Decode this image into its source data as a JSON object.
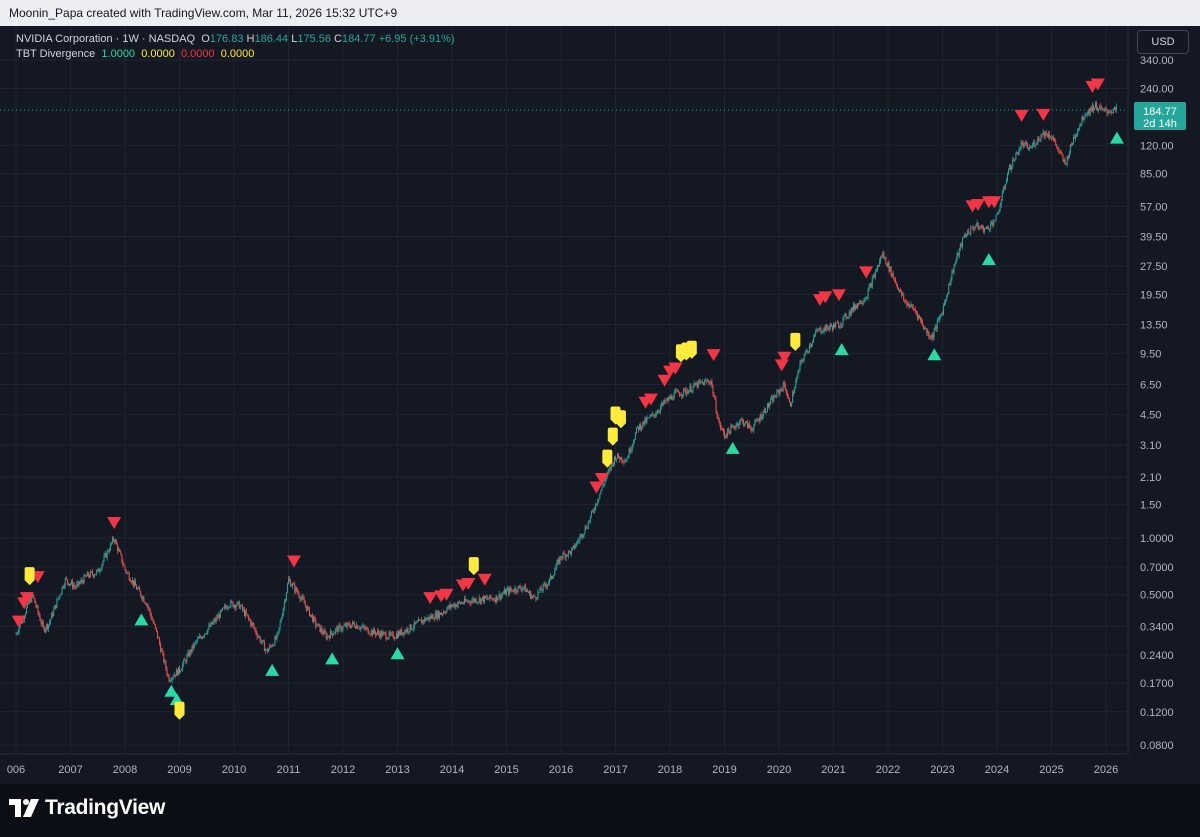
{
  "attribution": "Moonin_Papa created with TradingView.com, Mar 11, 2026 15:32 UTC+9",
  "legend": {
    "symbol": "NVIDIA Corporation · 1W · NASDAQ",
    "o_label": "O",
    "o_value": "176.83",
    "h_label": "H",
    "h_value": "186.44",
    "l_label": "L",
    "l_value": "175.56",
    "c_value": "184.77",
    "change": "+6.95 (+3.91%)",
    "indicator_name": "TBT Divergence",
    "indicator_values": [
      "1.0000",
      "0.0000",
      "0.0000",
      "0.0000"
    ]
  },
  "currency_button": "USD",
  "price_tag": {
    "value": "184.77",
    "countdown": "2d 14h"
  },
  "footer_logo": "TradingView",
  "colors": {
    "bull": "#26a69a",
    "bear": "#ef5350",
    "sell_signal": "#f23645",
    "buy_signal": "#2bd9a5",
    "hidden_signal": "#ffeb3b",
    "tag": "#26a69a"
  },
  "chart_data": {
    "type": "candlestick",
    "y_scale": "log",
    "x_range": [
      2006.0,
      2026.4
    ],
    "y_ticks": [
      "340.00",
      "240.00",
      "120.00",
      "85.00",
      "57.00",
      "39.50",
      "27.50",
      "19.50",
      "13.50",
      "9.50",
      "6.50",
      "4.50",
      "3.10",
      "2.10",
      "1.50",
      "1.0000",
      "0.7000",
      "0.5000",
      "0.3400",
      "0.2400",
      "0.1700",
      "0.1200",
      "0.0800"
    ],
    "x_ticks": [
      "006",
      "2007",
      "2008",
      "2009",
      "2010",
      "2011",
      "2012",
      "2013",
      "2014",
      "2015",
      "2016",
      "2017",
      "2018",
      "2019",
      "2020",
      "2021",
      "2022",
      "2023",
      "2024",
      "2025",
      "2026"
    ],
    "price_path": [
      [
        2006.0,
        0.31
      ],
      [
        2006.3,
        0.5
      ],
      [
        2006.5,
        0.33
      ],
      [
        2006.6,
        0.35
      ],
      [
        2006.9,
        0.6
      ],
      [
        2007.1,
        0.55
      ],
      [
        2007.3,
        0.63
      ],
      [
        2007.5,
        0.66
      ],
      [
        2007.8,
        1.0
      ],
      [
        2008.0,
        0.68
      ],
      [
        2008.2,
        0.55
      ],
      [
        2008.4,
        0.45
      ],
      [
        2008.6,
        0.3
      ],
      [
        2008.8,
        0.18
      ],
      [
        2009.0,
        0.2
      ],
      [
        2009.3,
        0.28
      ],
      [
        2009.6,
        0.35
      ],
      [
        2009.9,
        0.45
      ],
      [
        2010.1,
        0.44
      ],
      [
        2010.3,
        0.36
      ],
      [
        2010.6,
        0.25
      ],
      [
        2010.8,
        0.3
      ],
      [
        2011.0,
        0.6
      ],
      [
        2011.2,
        0.5
      ],
      [
        2011.5,
        0.35
      ],
      [
        2011.7,
        0.3
      ],
      [
        2011.9,
        0.33
      ],
      [
        2012.2,
        0.35
      ],
      [
        2012.5,
        0.32
      ],
      [
        2012.9,
        0.3
      ],
      [
        2013.2,
        0.33
      ],
      [
        2013.5,
        0.37
      ],
      [
        2013.8,
        0.4
      ],
      [
        2014.0,
        0.44
      ],
      [
        2014.4,
        0.47
      ],
      [
        2014.8,
        0.48
      ],
      [
        2015.0,
        0.52
      ],
      [
        2015.3,
        0.55
      ],
      [
        2015.5,
        0.48
      ],
      [
        2015.8,
        0.6
      ],
      [
        2016.0,
        0.8
      ],
      [
        2016.2,
        0.85
      ],
      [
        2016.5,
        1.2
      ],
      [
        2016.8,
        2.0
      ],
      [
        2017.0,
        2.7
      ],
      [
        2017.2,
        2.6
      ],
      [
        2017.4,
        3.8
      ],
      [
        2017.7,
        4.5
      ],
      [
        2017.9,
        5.2
      ],
      [
        2018.1,
        5.8
      ],
      [
        2018.3,
        6.0
      ],
      [
        2018.5,
        6.5
      ],
      [
        2018.75,
        6.8
      ],
      [
        2018.9,
        4.0
      ],
      [
        2019.0,
        3.5
      ],
      [
        2019.3,
        4.2
      ],
      [
        2019.5,
        3.8
      ],
      [
        2019.9,
        5.5
      ],
      [
        2020.1,
        6.5
      ],
      [
        2020.2,
        5.0
      ],
      [
        2020.4,
        8.5
      ],
      [
        2020.7,
        12.5
      ],
      [
        2020.9,
        13.0
      ],
      [
        2021.1,
        13.5
      ],
      [
        2021.4,
        17.0
      ],
      [
        2021.6,
        19.0
      ],
      [
        2021.9,
        32.0
      ],
      [
        2022.1,
        24.0
      ],
      [
        2022.3,
        18.0
      ],
      [
        2022.5,
        16.0
      ],
      [
        2022.7,
        12.5
      ],
      [
        2022.8,
        11.5
      ],
      [
        2023.0,
        16.0
      ],
      [
        2023.2,
        27.0
      ],
      [
        2023.4,
        40.0
      ],
      [
        2023.6,
        45.0
      ],
      [
        2023.8,
        43.0
      ],
      [
        2024.0,
        50.0
      ],
      [
        2024.2,
        87.0
      ],
      [
        2024.45,
        122.0
      ],
      [
        2024.6,
        115.0
      ],
      [
        2024.85,
        140.0
      ],
      [
        2025.0,
        135.0
      ],
      [
        2025.25,
        95.0
      ],
      [
        2025.4,
        130.0
      ],
      [
        2025.6,
        175.0
      ],
      [
        2025.8,
        195.0
      ],
      [
        2025.95,
        182.0
      ],
      [
        2026.2,
        184.77
      ]
    ],
    "sell_signals": [
      [
        2006.05,
        0.36
      ],
      [
        2006.15,
        0.45
      ],
      [
        2006.2,
        0.48
      ],
      [
        2006.4,
        0.62
      ],
      [
        2007.8,
        1.2
      ],
      [
        2011.1,
        0.75
      ],
      [
        2013.6,
        0.48
      ],
      [
        2013.8,
        0.49
      ],
      [
        2013.9,
        0.5
      ],
      [
        2014.2,
        0.56
      ],
      [
        2014.3,
        0.57
      ],
      [
        2014.6,
        0.6
      ],
      [
        2016.65,
        1.85
      ],
      [
        2016.75,
        2.05
      ],
      [
        2017.55,
        5.2
      ],
      [
        2017.65,
        5.4
      ],
      [
        2017.9,
        6.8
      ],
      [
        2018.0,
        7.6
      ],
      [
        2018.1,
        7.9
      ],
      [
        2018.8,
        9.3
      ],
      [
        2020.05,
        8.2
      ],
      [
        2020.1,
        9.0
      ],
      [
        2020.75,
        18.2
      ],
      [
        2020.85,
        18.8
      ],
      [
        2021.1,
        19.3
      ],
      [
        2021.6,
        25.5
      ],
      [
        2023.55,
        57.0
      ],
      [
        2023.65,
        58.0
      ],
      [
        2023.85,
        60.0
      ],
      [
        2023.95,
        60.0
      ],
      [
        2024.45,
        172.0
      ],
      [
        2024.85,
        174.0
      ],
      [
        2025.75,
        245.0
      ],
      [
        2025.85,
        252.0
      ]
    ],
    "buy_signals": [
      [
        2008.3,
        0.37
      ],
      [
        2008.85,
        0.155
      ],
      [
        2008.95,
        0.14
      ],
      [
        2010.7,
        0.2
      ],
      [
        2011.8,
        0.23
      ],
      [
        2013.0,
        0.245
      ],
      [
        2019.15,
        3.0
      ],
      [
        2021.15,
        10.0
      ],
      [
        2022.85,
        9.4
      ],
      [
        2023.85,
        30.0
      ],
      [
        2026.2,
        132.0
      ]
    ],
    "hidden_signals": [
      [
        2006.25,
        0.62
      ],
      [
        2009.0,
        0.12
      ],
      [
        2014.4,
        0.7
      ],
      [
        2016.85,
        2.6
      ],
      [
        2016.95,
        3.4
      ],
      [
        2017.0,
        4.4
      ],
      [
        2017.1,
        4.2
      ],
      [
        2018.2,
        9.4
      ],
      [
        2018.3,
        9.6
      ],
      [
        2018.4,
        9.8
      ],
      [
        2020.3,
        10.8
      ]
    ],
    "last_price": 184.77
  }
}
